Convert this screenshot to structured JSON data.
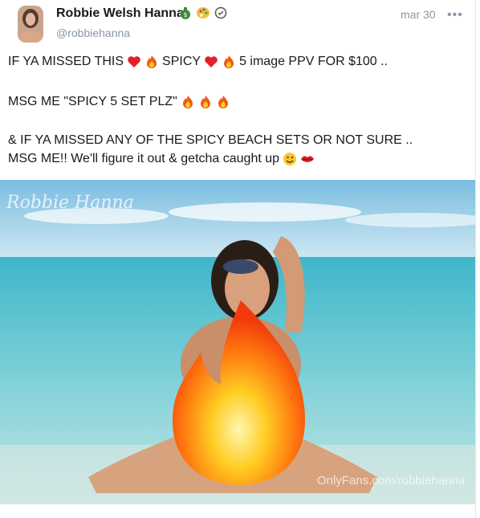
{
  "post": {
    "author_name": "Robbie Welsh Hanna",
    "author_handle": "@robbiehanna",
    "date": "mar 30",
    "more_label": "•••",
    "line1_a": "IF YA MISSED THIS",
    "line1_b": "SPICY",
    "line1_c": "5 image PPV FOR $100 ..",
    "line2": "MSG ME \"SPICY 5 SET PLZ\"",
    "line3": "& IF YA MISSED ANY OF THE SPICY BEACH SETS OR NOT SURE ..",
    "line4": "MSG ME!! We'll figure it out & getcha caught up",
    "watermark_signature": "Robbie Hanna",
    "watermark_url": "OnlyFans.com/robbiehanna"
  },
  "icons": {
    "badge1": "money-bag-icon",
    "badge2": "palette-icon",
    "verified": "verified-check-icon",
    "heart": "red-heart-emoji",
    "fire": "fire-emoji",
    "wink": "wink-emoji",
    "lips": "lips-emoji"
  },
  "colors": {
    "meta_gray": "#8a96a3",
    "text": "#1a1a1a",
    "sky": "#9ed3ec",
    "sea": "#6fc9d4"
  }
}
